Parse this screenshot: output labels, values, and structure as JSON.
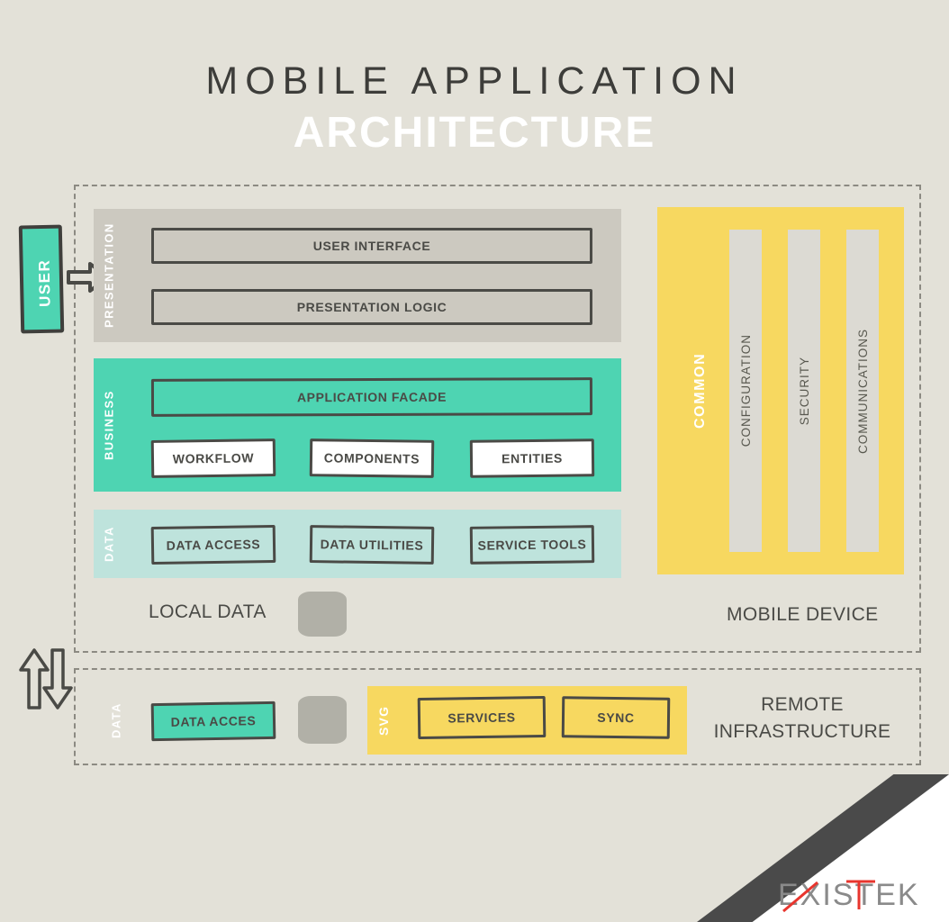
{
  "title": {
    "line1": "MOBILE APPLICATION",
    "line2": "ARCHITECTURE"
  },
  "actor": {
    "label": "USER"
  },
  "mobile_device": {
    "caption": "MOBILE DEVICE",
    "layers": [
      {
        "side_label": "PRESENTATION",
        "items": [
          "USER INTERFACE",
          "PRESENTATION LOGIC"
        ]
      },
      {
        "side_label": "BUSINESS",
        "items": [
          "APPLICATION FACADE",
          "WORKFLOW",
          "COMPONENTS",
          "ENTITIES"
        ]
      },
      {
        "side_label": "DATA",
        "items": [
          "DATA ACCESS",
          "DATA UTILITIES",
          "SERVICE TOOLS"
        ]
      }
    ],
    "presentation": {
      "side_label": "PRESENTATION",
      "user_interface": "USER INTERFACE",
      "presentation_logic": "PRESENTATION LOGIC"
    },
    "business": {
      "side_label": "BUSINESS",
      "application_facade": "APPLICATION FACADE",
      "workflow": "WORKFLOW",
      "components": "COMPONENTS",
      "entities": "ENTITIES"
    },
    "data": {
      "side_label": "DATA",
      "data_access": "DATA ACCESS",
      "data_utilities": "DATA UTILITIES",
      "service_tools": "SERVICE TOOLS"
    },
    "local_data_label": "LOCAL DATA",
    "common": {
      "side_label": "COMMON",
      "columns": [
        "CONFIGURATION",
        "SECURITY",
        "COMMUNICATIONS"
      ]
    }
  },
  "remote_infrastructure": {
    "caption_line1": "REMOTE",
    "caption_line2": "INFRASTRUCTURE",
    "data": {
      "side_label": "DATA",
      "data_access": "DATA ACCES"
    },
    "svg": {
      "side_label": "SVG",
      "services": "SERVICES",
      "sync": "SYNC"
    }
  },
  "brand": {
    "name": "EXISTEK"
  },
  "colors": {
    "background": "#e3e1d8",
    "teal": "#4ed4b2",
    "mint": "#bee3dc",
    "yellow": "#f7d860",
    "gray_band": "#ccc9c0",
    "column_gray": "#dcdad3",
    "ink": "#4a4a46",
    "brand_red": "#e8352e",
    "brand_gray": "#8a8a8a"
  }
}
